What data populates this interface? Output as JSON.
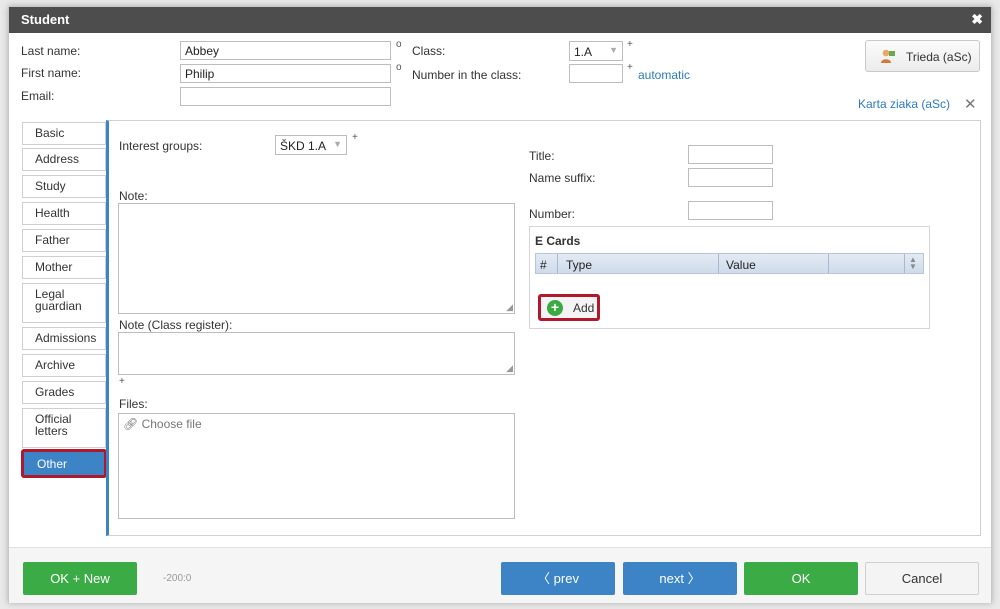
{
  "dialog": {
    "title": "Student",
    "close_glyph": "✖"
  },
  "header": {
    "last_name_label": "Last name:",
    "last_name_value": "Abbey",
    "first_name_label": "First name:",
    "first_name_value": "Philip",
    "email_label": "Email:",
    "email_value": "",
    "circle_mark": "o",
    "class_label": "Class:",
    "class_value": "1.A",
    "number_label": "Number in the class:",
    "number_value": "",
    "plus_mark": "+",
    "automatic_link": "automatic",
    "trieda_button": "Trieda (aSc)",
    "karta_link": "Karta ziaka (aSc)"
  },
  "tabs": [
    {
      "label": "Basic",
      "active": false
    },
    {
      "label": "Address",
      "active": false
    },
    {
      "label": "Study",
      "active": false
    },
    {
      "label": "Health",
      "active": false
    },
    {
      "label": "Father",
      "active": false
    },
    {
      "label": "Mother",
      "active": false
    },
    {
      "label": "Legal guardian",
      "active": false
    },
    {
      "label": "Admissions",
      "active": false
    },
    {
      "label": "Archive",
      "active": false
    },
    {
      "label": "Grades",
      "active": false
    },
    {
      "label": "Official letters",
      "active": false
    },
    {
      "label": "Other",
      "active": true
    }
  ],
  "panel": {
    "interest_groups_label": "Interest groups:",
    "interest_groups_value": "ŠKD 1.A",
    "note_label": "Note:",
    "note_class_label": "Note (Class register):",
    "files_label": "Files:",
    "choose_file": "Choose file",
    "title_label": "Title:",
    "name_suffix_label": "Name suffix:",
    "number_label": "Number:",
    "ecards": {
      "heading": "E Cards",
      "columns": [
        "#",
        "Type",
        "Value"
      ],
      "add_button": "Add"
    }
  },
  "footer": {
    "ok_new": "OK + New",
    "counter": "-200:0",
    "prev": "prev",
    "next": "next",
    "ok": "OK",
    "cancel": "Cancel"
  },
  "colors": {
    "accent_blue": "#3d84c6",
    "green": "#3aab45",
    "highlight_red": "#b0182b",
    "title_bar": "#4d4d4d"
  }
}
